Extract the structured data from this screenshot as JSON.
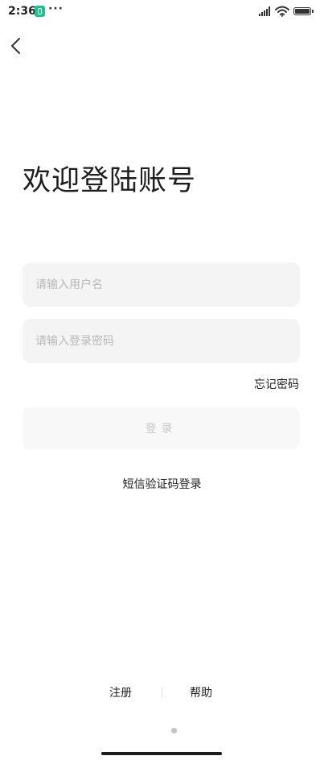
{
  "status_bar": {
    "time": "2:36",
    "more_indicator": "···",
    "icons": [
      "app-notification-icon",
      "signal-icon",
      "wifi-icon",
      "battery-icon"
    ]
  },
  "nav": {
    "back_icon": "chevron-left-icon"
  },
  "login": {
    "title": "欢迎登陆账号",
    "username_placeholder": "请输入用户名",
    "username_value": "",
    "password_placeholder": "请输入登录密码",
    "password_value": "",
    "forgot_password": "忘记密码",
    "login_button": "登录",
    "sms_login": "短信验证码登录"
  },
  "footer": {
    "register": "注册",
    "help": "帮助"
  },
  "colors": {
    "input_background": "#f4f4f4",
    "button_background": "#f8f8f8",
    "button_text_disabled": "#c9c9c9",
    "placeholder": "#b8b8b8",
    "app_icon": "#1fbf8f"
  }
}
